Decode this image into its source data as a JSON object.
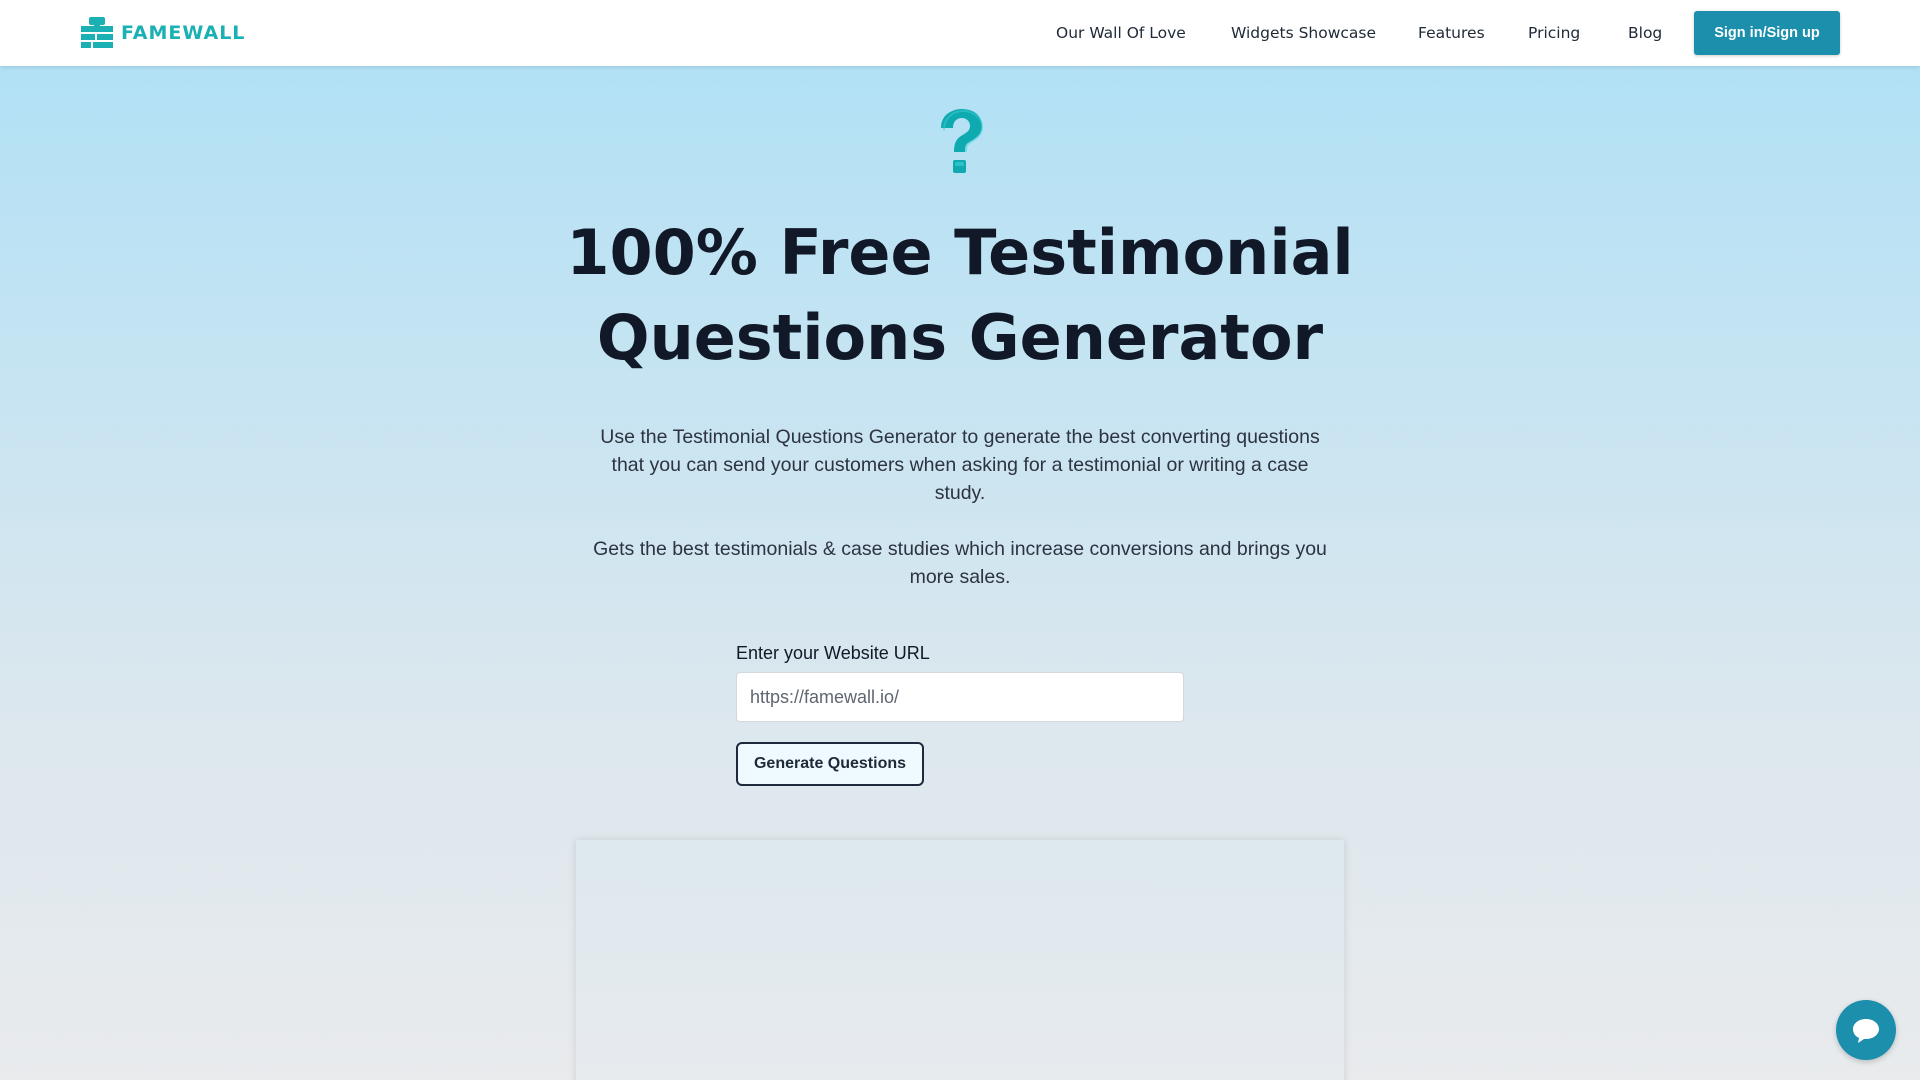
{
  "brand": {
    "name": "FAMEWALL",
    "accent_color": "#1bb0b3",
    "primary_button_color": "#1b8fab"
  },
  "nav": {
    "items": [
      {
        "label": "Our Wall Of Love"
      },
      {
        "label": "Widgets Showcase"
      },
      {
        "label": "Features"
      },
      {
        "label": "Pricing"
      },
      {
        "label": "Blog"
      }
    ],
    "signin_label": "Sign in/Sign up"
  },
  "hero": {
    "icon": "question-mark-icon",
    "title_line1": "100% Free Testimonial",
    "title_line2": "Questions Generator",
    "description1": "Use the Testimonial Questions Generator to generate the best converting questions that you can send your customers when asking for a testimonial or writing a case study.",
    "description2": "Gets the best testimonials & case studies which increase conversions and brings you more sales."
  },
  "form": {
    "url_label": "Enter your Website URL",
    "url_placeholder": "https://famewall.io/",
    "generate_label": "Generate Questions"
  },
  "chat": {
    "icon": "chat-bubble-icon"
  }
}
